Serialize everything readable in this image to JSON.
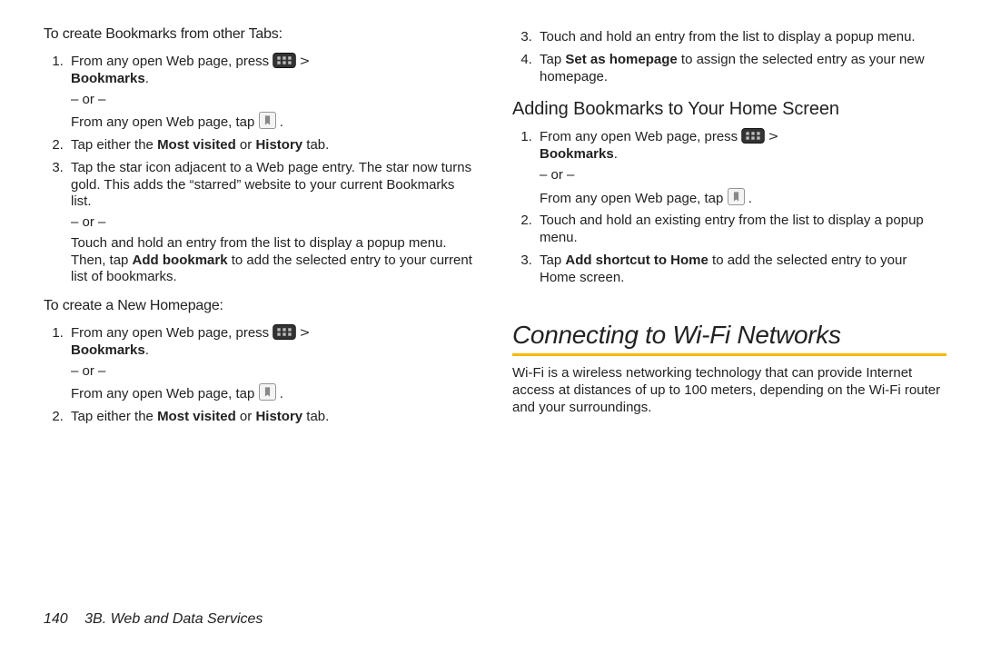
{
  "left": {
    "h_tabs": "To create Bookmarks from other Tabs:",
    "tabs_list": {
      "i1_a": "From any open Web page, press ",
      "i1_b_chevron": ">",
      "i1_bookmarks": "Bookmarks",
      "i1_period": ".",
      "or": "– or –",
      "i1_tap": "From any open Web page, tap ",
      "i1_tap_period": ".",
      "i2_a": "Tap either the ",
      "i2_mv": "Most visited",
      "i2_or": " or ",
      "i2_hist": "History",
      "i2_tab": " tab.",
      "i3_a": "Tap the star icon adjacent to a Web page entry. The star now turns gold. This adds the “starred” website to your current Bookmarks list.",
      "i3_touch": "Touch and hold an entry from the list to display a popup menu. Then, tap ",
      "i3_addbm": "Add bookmark",
      "i3_tail": " to add the selected entry to your current list of bookmarks."
    },
    "h_home": "To create a New Homepage:",
    "home_list": {
      "i1_a": "From any open Web page, press ",
      "i1_bookmarks": "Bookmarks",
      "i1_period": ".",
      "i1_tap": "From any open Web page, tap ",
      "i1_tap_period": ".",
      "i2_a": "Tap either the ",
      "i2_mv": "Most visited",
      "i2_or": " or ",
      "i2_hist": "History",
      "i2_tab": " tab."
    }
  },
  "right": {
    "cont_list": {
      "i3": "Touch and hold an entry from the list to display a popup menu.",
      "i4_a": "Tap ",
      "i4_set": "Set as homepage",
      "i4_b": " to assign the selected entry as your new homepage."
    },
    "h_add": "Adding Bookmarks to Your Home Screen",
    "add_list": {
      "i1_a": "From any open Web page, press ",
      "i1_bookmarks": "Bookmarks",
      "i1_period": ".",
      "or": "– or –",
      "i1_tap": "From any open Web page, tap ",
      "i1_tap_period": ".",
      "i2": "Touch and hold an existing entry from the list to display a popup menu.",
      "i3_a": "Tap ",
      "i3_short": "Add shortcut to Home",
      "i3_b": " to add the selected entry to your Home screen."
    },
    "h2": "Connecting to Wi-Fi Networks",
    "wifi_p": "Wi-Fi is a wireless networking technology that can provide Internet access at distances of up to 100 meters, depending on the Wi-Fi router and your surroundings."
  },
  "footer": {
    "page": "140",
    "chapter": "3B. Web and Data Services"
  }
}
